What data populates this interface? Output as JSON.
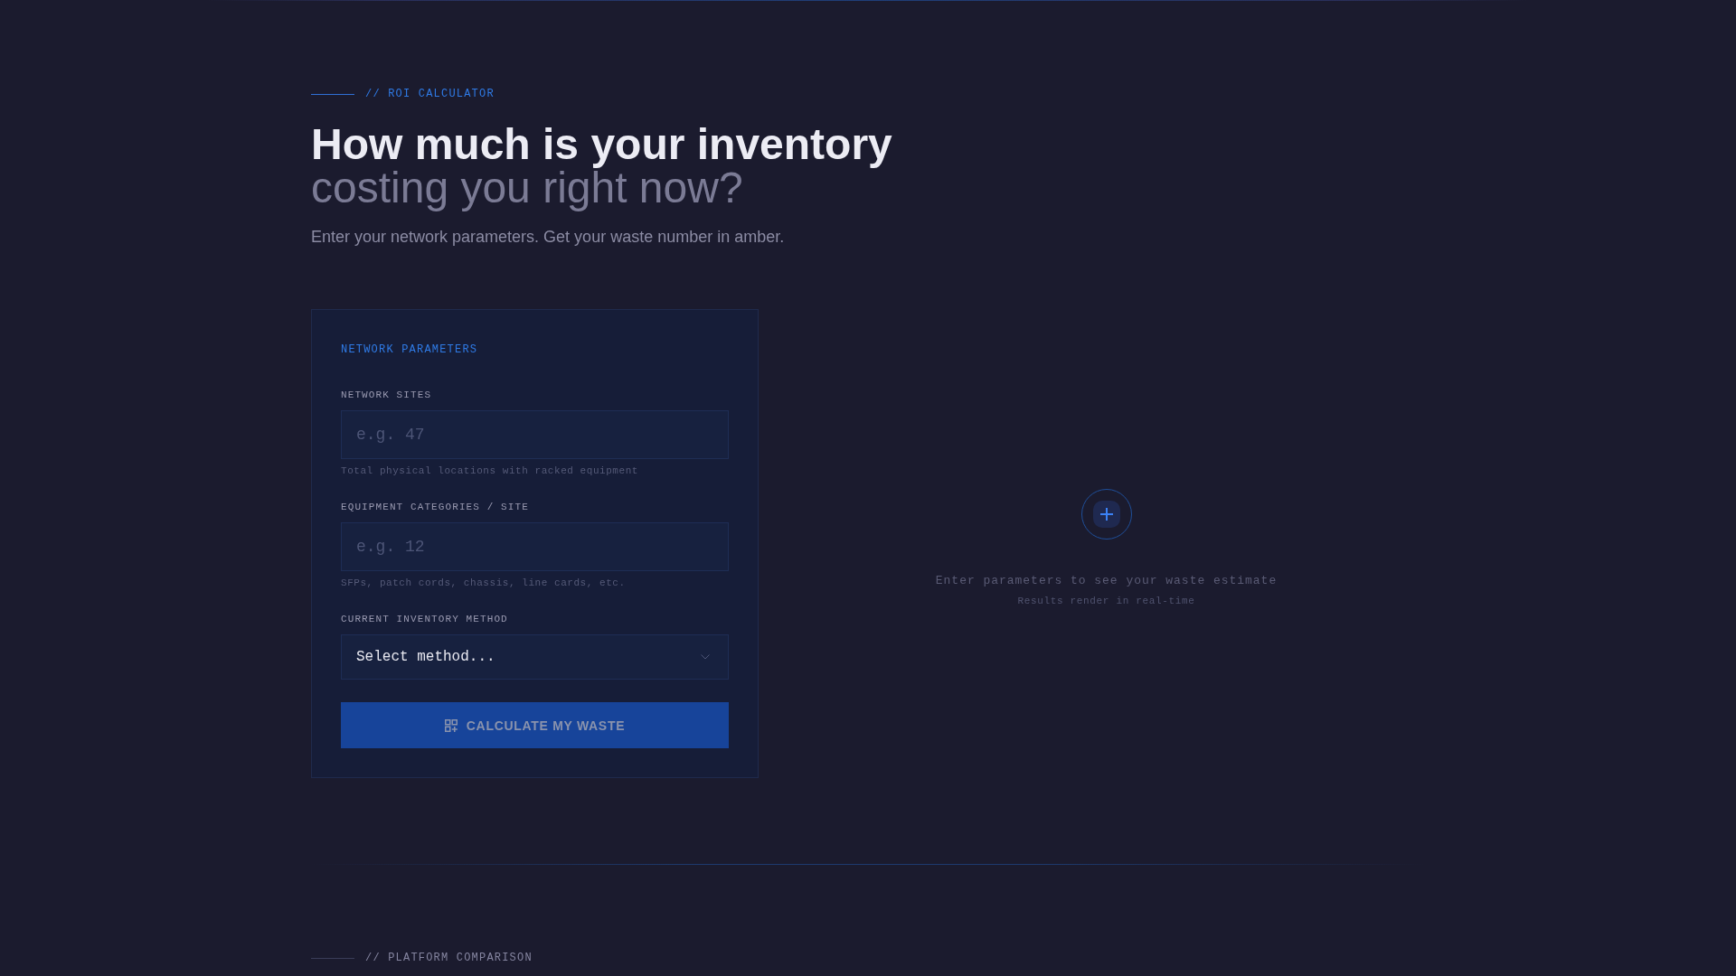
{
  "roi_section": {
    "eyebrow": {
      "text": "// ROI CALCULATOR",
      "active": true
    },
    "heading": {
      "line_1": "How much is your inventory",
      "line_2": "costing you right now?"
    },
    "subtitle": "Enter your network parameters. Get your waste number in amber.",
    "parameters_card": {
      "title": "NETWORK PARAMETERS",
      "fields": [
        {
          "kind": "number",
          "label": "NETWORK SITES",
          "placeholder": "e.g. 47",
          "hint": "Total physical locations with racked equipment"
        },
        {
          "kind": "number",
          "label": "EQUIPMENT CATEGORIES / SITE",
          "placeholder": "e.g. 12",
          "hint": "SFPs, patch cords, chassis, line cards, etc."
        },
        {
          "kind": "select",
          "label": "CURRENT INVENTORY METHOD",
          "value": "Select method..."
        }
      ],
      "submit_button": {
        "label": "CALCULATE MY WASTE",
        "disabled": true
      }
    },
    "results_panel": {
      "message": "Enter parameters to see your waste estimate",
      "note": "Results render in real-time"
    }
  },
  "comparison_section": {
    "eyebrow": {
      "text": "// PLATFORM COMPARISON",
      "active": false
    }
  }
}
